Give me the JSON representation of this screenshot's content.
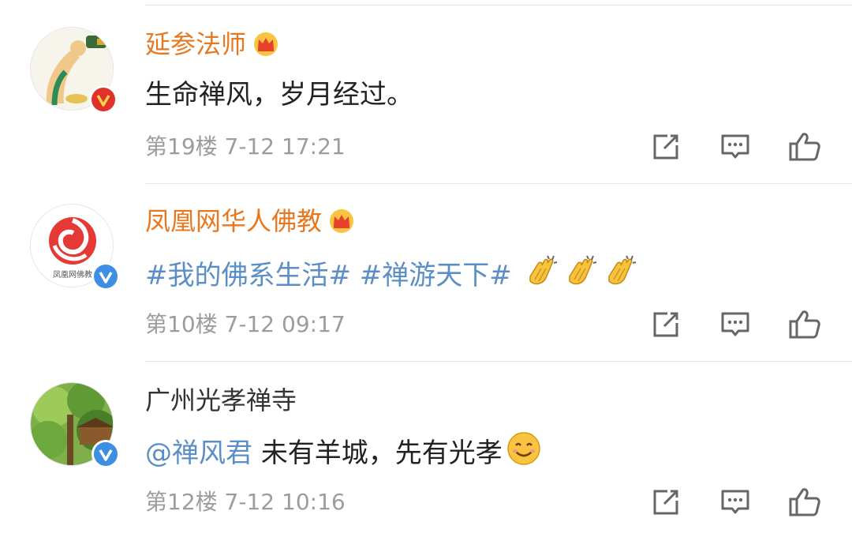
{
  "comments": [
    {
      "username": "延参法师",
      "text": "生命禅风，岁月经过。",
      "floor": "第19楼",
      "date": "7-12",
      "time": "17:21",
      "crown": true,
      "verified": "red"
    },
    {
      "username": "凤凰网华人佛教",
      "hashtag1": "#我的佛系生活#",
      "hashtag2": "#禅游天下#",
      "floor": "第10楼",
      "date": "7-12",
      "time": "09:17",
      "crown": true,
      "verified": "blue",
      "avatar_text": "凤凰网佛教"
    },
    {
      "username": "广州光孝禅寺",
      "mention": "@禅风君",
      "text": "未有羊城，先有光孝",
      "floor": "第12楼",
      "date": "7-12",
      "time": "10:16",
      "crown": false,
      "verified": "blue"
    }
  ],
  "icons": [
    "repost-icon",
    "comment-icon",
    "like-icon",
    "crown-icon",
    "verified-icon",
    "clap-emoji-icon",
    "smile-emoji-icon"
  ],
  "colors": {
    "username": "#e8781f",
    "link": "#5b8ec7",
    "meta": "#9c9c9c",
    "verified_blue": "#3e8fe3",
    "verified_red": "#e0322a"
  }
}
